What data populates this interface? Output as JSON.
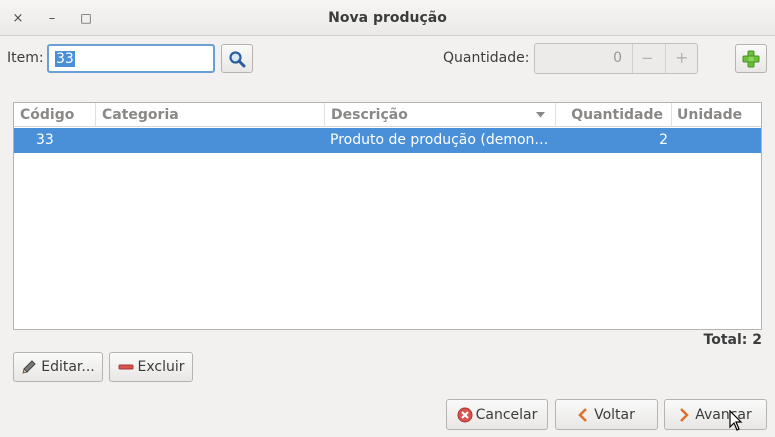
{
  "window": {
    "title": "Nova produção",
    "close_glyph": "×",
    "minimize_glyph": "–",
    "maximize_glyph": "□"
  },
  "item": {
    "label": "Item:",
    "value": "33",
    "search_icon": "search-icon"
  },
  "quantity": {
    "label": "Quantidade:",
    "value": "0",
    "minus_glyph": "−",
    "plus_glyph": "+",
    "add_icon": "add-icon"
  },
  "table": {
    "columns": [
      "Código",
      "Categoria",
      "Descrição",
      "Quantidade",
      "Unidade"
    ],
    "sort_column": "Descrição",
    "rows": [
      {
        "codigo": "33",
        "categoria": "",
        "descricao": "Produto de produção (demon…",
        "quantidade": "2",
        "unidade": "",
        "selected": true
      }
    ]
  },
  "total": {
    "label": "Total:",
    "value": "2"
  },
  "actions": {
    "edit_label": "Editar...",
    "delete_label": "Excluir"
  },
  "footer": {
    "cancel_label": "Cancelar",
    "back_label": "Voltar",
    "next_label": "Avançar"
  },
  "colors": {
    "selection": "#4a90d9",
    "window_bg": "#f2f1f0",
    "delete_red": "#d9534f",
    "nav_orange": "#e0702a",
    "add_green": "#6cbf3a"
  }
}
